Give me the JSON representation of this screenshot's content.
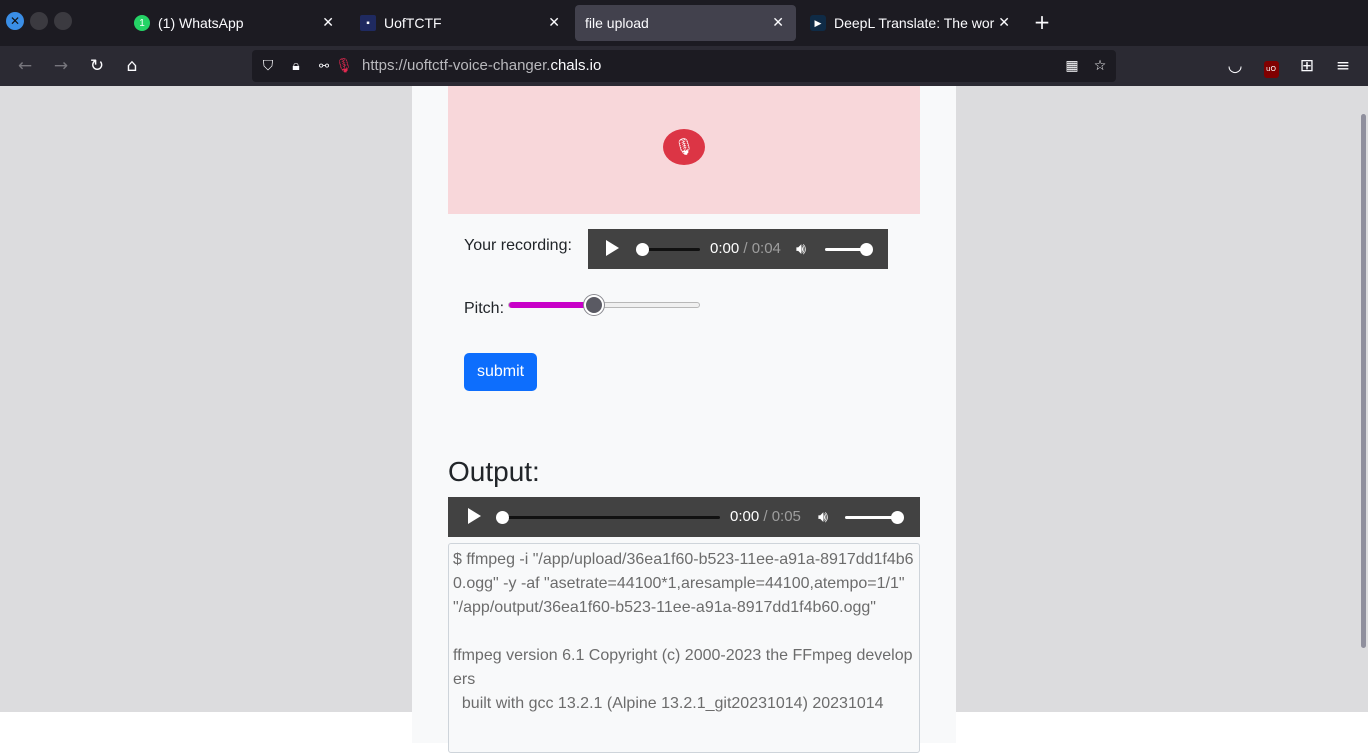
{
  "browser": {
    "tabs": [
      {
        "label": "(1) WhatsApp",
        "icon": "whatsapp-icon",
        "badge": "1"
      },
      {
        "label": "UofTCTF",
        "icon": "uoftctf-icon"
      },
      {
        "label": "file upload",
        "icon": "",
        "active": true
      },
      {
        "label": "DeepL Translate: The wor",
        "icon": "deepl-icon"
      }
    ],
    "url_prefix": "https://uoftctf-voice-changer.",
    "url_domain": "chals.io"
  },
  "page": {
    "recording_label": "Your recording:",
    "recording_audio": {
      "current": "0:00",
      "duration": "/ 0:04",
      "progress": 0,
      "volume": 1
    },
    "pitch_label": "Pitch:",
    "pitch_value": 0.45,
    "submit_label": "submit",
    "output_title": "Output:",
    "output_audio": {
      "current": "0:00",
      "duration": "/ 0:05",
      "progress": 0,
      "volume": 1
    },
    "console_text": "$ ffmpeg -i \"/app/upload/36ea1f60-b523-11ee-a91a-8917dd1f4b60.ogg\" -y -af \"asetrate=44100*1,aresample=44100,atempo=1/1\" \"/app/output/36ea1f60-b523-11ee-a91a-8917dd1f4b60.ogg\"\n\nffmpeg version 6.1 Copyright (c) 2000-2023 the FFmpeg developers\n  built with gcc 13.2.1 (Alpine 13.2.1_git20231014) 20231014"
  },
  "colors": {
    "accent": "#0d6efd",
    "mic": "#dc3545",
    "record_box": "#f8d7da",
    "pitch_fill": "#c800c8"
  }
}
